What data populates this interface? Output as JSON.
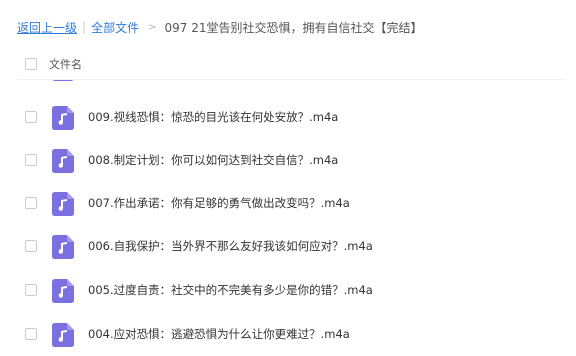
{
  "breadcrumb": {
    "back_label": "返回上一级",
    "separator": "|",
    "all_files_label": "全部文件",
    "arrow": ">",
    "current_folder": "097 21堂告别社交恐惧，拥有自信社交【完结】"
  },
  "list_header": {
    "column_name": "文件名"
  },
  "files": [
    {
      "name": "009.视线恐惧：惊恐的目光该在何处安放？.m4a",
      "icon": "music-file-icon"
    },
    {
      "name": "008.制定计划：你可以如何达到社交自信？.m4a",
      "icon": "music-file-icon"
    },
    {
      "name": "007.作出承诺：你有足够的勇气做出改变吗？.m4a",
      "icon": "music-file-icon"
    },
    {
      "name": "006.自我保护：当外界不那么友好我该如何应对？.m4a",
      "icon": "music-file-icon"
    },
    {
      "name": "005.过度自责：社交中的不完美有多少是你的错？.m4a",
      "icon": "music-file-icon"
    },
    {
      "name": "004.应对恐惧：逃避恐惧为什么让你更难过？.m4a",
      "icon": "music-file-icon"
    }
  ],
  "colors": {
    "link": "#2f7ddb",
    "icon": "#7c6fe0"
  }
}
